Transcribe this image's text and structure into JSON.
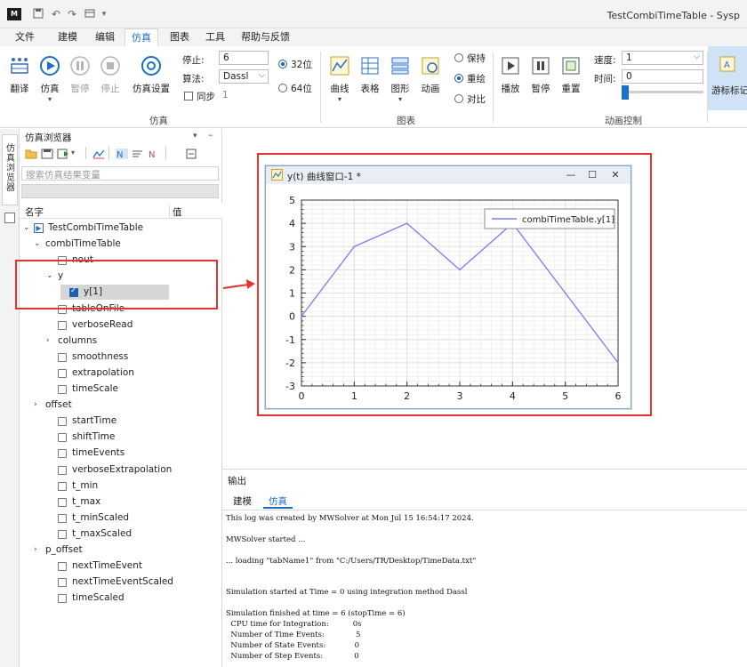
{
  "window": {
    "title": "TestCombiTimeTable - Sysp",
    "logo": "M",
    "quick_access": [
      "save-icon",
      "undo-icon",
      "redo-icon",
      "layout-icon"
    ]
  },
  "menu": {
    "tabs": [
      {
        "label": "文件"
      },
      {
        "label": "建模"
      },
      {
        "label": "编辑"
      },
      {
        "label": "仿真",
        "active": true
      },
      {
        "label": "图表"
      },
      {
        "label": "工具"
      },
      {
        "label": "帮助与反馈"
      }
    ]
  },
  "ribbon": {
    "sim_group": {
      "label": "仿真",
      "buttons": [
        {
          "label": "翻译",
          "icon": "translate-icon"
        },
        {
          "label": "仿真",
          "icon": "play-icon"
        },
        {
          "label": "暂停",
          "icon": "pause-icon",
          "disabled": true
        },
        {
          "label": "停止",
          "icon": "stop-icon",
          "disabled": true
        },
        {
          "label": "仿真设置",
          "icon": "settings-icon"
        }
      ],
      "stop_label": "停止:",
      "stop_value": "6",
      "algorithm_label": "算法:",
      "algorithm_value": "Dassl",
      "sync_label": "同步",
      "sync_value": "1",
      "bit32_label": "32位",
      "bit64_label": "64位",
      "bit32_selected": true
    },
    "chart_group": {
      "label": "图表",
      "buttons": [
        {
          "label": "曲线",
          "icon": "curve-icon"
        },
        {
          "label": "表格",
          "icon": "table-icon"
        },
        {
          "label": "图形",
          "icon": "graphic-icon"
        },
        {
          "label": "动画",
          "icon": "animation-icon"
        }
      ],
      "radio_keep": "保持",
      "radio_overlay": "重绘",
      "radio_compare": "对比",
      "selected": "重绘"
    },
    "anim_group": {
      "label": "动画控制",
      "buttons": [
        {
          "label": "播放",
          "icon": "anim-play-icon"
        },
        {
          "label": "暂停",
          "icon": "anim-pause-icon"
        },
        {
          "label": "重置",
          "icon": "anim-reset-icon"
        }
      ],
      "speed_label": "速度:",
      "speed_value": "1",
      "time_label": "时间:",
      "time_value": "0",
      "cursor_label": "游标标记"
    }
  },
  "left_strip": {
    "label": "仿真浏览器"
  },
  "browser": {
    "title": "仿真浏览器",
    "search_placeholder": "搜索仿真结果变量",
    "col_name": "名字",
    "col_value": "值",
    "tree": [
      {
        "label": "TestCombiTimeTable",
        "level": 0,
        "expanded": true,
        "type": "root"
      },
      {
        "label": "combiTimeTable",
        "level": 1,
        "expanded": true,
        "type": "group"
      },
      {
        "label": "nout",
        "level": 2,
        "type": "leaf",
        "checked": false
      },
      {
        "label": "y",
        "level": 2,
        "expanded": true,
        "type": "group"
      },
      {
        "label": "y[1]",
        "level": 3,
        "type": "leaf",
        "checked": true
      },
      {
        "label": "tableOnFile",
        "level": 2,
        "type": "leaf",
        "checked": false
      },
      {
        "label": "verboseRead",
        "level": 2,
        "type": "leaf",
        "checked": false
      },
      {
        "label": "columns",
        "level": 2,
        "expanded": false,
        "type": "group"
      },
      {
        "label": "smoothness",
        "level": 2,
        "type": "leaf",
        "checked": false
      },
      {
        "label": "extrapolation",
        "level": 2,
        "type": "leaf",
        "checked": false
      },
      {
        "label": "timeScale",
        "level": 2,
        "type": "leaf",
        "checked": false
      },
      {
        "label": "offset",
        "level": 1,
        "expanded": false,
        "type": "group"
      },
      {
        "label": "startTime",
        "level": 2,
        "type": "leaf",
        "checked": false
      },
      {
        "label": "shiftTime",
        "level": 2,
        "type": "leaf",
        "checked": false
      },
      {
        "label": "timeEvents",
        "level": 2,
        "type": "leaf",
        "checked": false
      },
      {
        "label": "verboseExtrapolation",
        "level": 2,
        "type": "leaf",
        "checked": false
      },
      {
        "label": "t_min",
        "level": 2,
        "type": "leaf",
        "checked": false
      },
      {
        "label": "t_max",
        "level": 2,
        "type": "leaf",
        "checked": false
      },
      {
        "label": "t_minScaled",
        "level": 2,
        "type": "leaf",
        "checked": false
      },
      {
        "label": "t_maxScaled",
        "level": 2,
        "type": "leaf",
        "checked": false
      },
      {
        "label": "p_offset",
        "level": 1,
        "expanded": false,
        "type": "group"
      },
      {
        "label": "nextTimeEvent",
        "level": 2,
        "type": "leaf",
        "checked": false
      },
      {
        "label": "nextTimeEventScaled",
        "level": 2,
        "type": "leaf",
        "checked": false
      },
      {
        "label": "timeScaled",
        "level": 2,
        "type": "leaf",
        "checked": false
      }
    ]
  },
  "plot_window": {
    "title": "y(t) 曲线窗口-1 *",
    "btn_minimize": "—",
    "btn_maximize": "☐",
    "btn_close": "✕"
  },
  "chart_data": {
    "type": "line",
    "title": "",
    "xlabel": "",
    "ylabel": "",
    "x": [
      0,
      1,
      2,
      3,
      4,
      5,
      6
    ],
    "series": [
      {
        "name": "combiTimeTable.y[1]",
        "values": [
          0,
          3,
          4,
          2,
          4,
          1,
          -2
        ],
        "color": "#7b7bf0"
      }
    ],
    "xlim": [
      0,
      6
    ],
    "ylim": [
      -3,
      5
    ],
    "x_ticks": [
      0,
      1,
      2,
      3,
      4,
      5,
      6
    ],
    "y_ticks": [
      -3,
      -2,
      -1,
      0,
      1,
      2,
      3,
      4,
      5
    ],
    "grid": true,
    "legend": "top-right"
  },
  "output": {
    "title": "输出",
    "tabs": [
      {
        "label": "建模"
      },
      {
        "label": "仿真",
        "active": true
      }
    ],
    "log": [
      "This log was created by MWSolver at Mon Jul 15 16:54:17 2024.",
      "",
      "MWSolver started ...",
      "",
      "... loading \"tabName1\" from \"C:/Users/TR/Desktop/TimeData.txt\"",
      "",
      "",
      "Simulation started at Time = 0 using integration method Dassl",
      "",
      "Simulation finished at time = 6 (stopTime = 6)",
      "  CPU time for Integration:          0s",
      "  Number of Time Events:             5",
      "  Number of State Events:            0",
      "  Number of Step Events:             0"
    ]
  },
  "colors": {
    "accent": "#1d6ec9",
    "annotation_red": "#e53333",
    "series": "#7b7bf0"
  }
}
